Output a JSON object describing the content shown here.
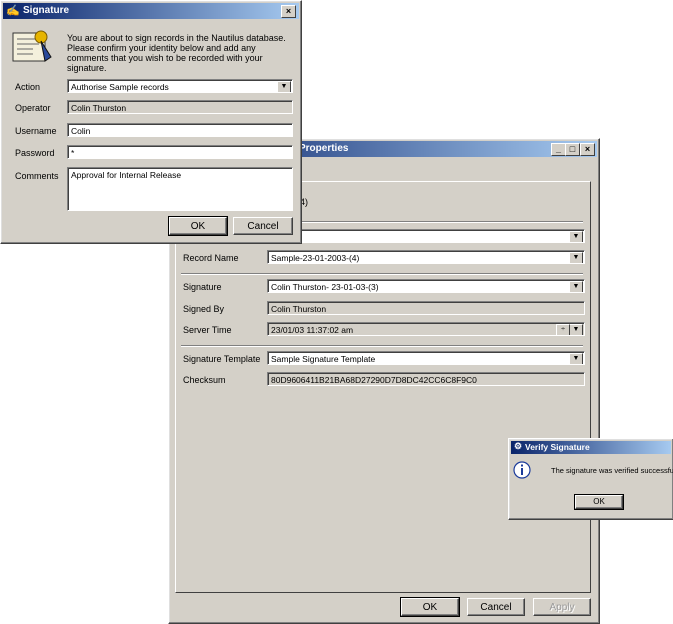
{
  "props": {
    "title": "Properties",
    "header_text": "(4)",
    "top_select": "",
    "labels": {
      "record_name": "Record Name",
      "signature": "Signature",
      "signed_by": "Signed By",
      "server_time": "Server Time",
      "signature_template": "Signature Template",
      "checksum": "Checksum"
    },
    "values": {
      "record_name": "Sample-23-01-2003-(4)",
      "signature": "Colin Thurston- 23-01-03-(3)",
      "signed_by": "Colin Thurston",
      "server_time": "23/01/03 11:37:02 am",
      "signature_template": "Sample Signature Template",
      "checksum": "80D9606411B21BA68D27290D7D8DC42CC6C8F9C0"
    },
    "buttons": {
      "ok": "OK",
      "cancel": "Cancel",
      "apply": "Apply"
    }
  },
  "sig": {
    "title": "Signature",
    "message": "You are about to sign records in the Nautilus database. Please confirm your identity below and add any comments that you wish to be recorded with your signature.",
    "labels": {
      "action": "Action",
      "operator": "Operator",
      "username": "Username",
      "password": "Password",
      "comments": "Comments"
    },
    "values": {
      "action": "Authorise Sample records",
      "operator": "Colin Thurston",
      "username": "Colin",
      "password": "*",
      "comments": "Approval for Internal Release"
    },
    "buttons": {
      "ok": "OK",
      "cancel": "Cancel"
    },
    "close": "×"
  },
  "verify": {
    "title": "Verify Signature",
    "message": "The signature was verified successfully",
    "ok": "OK"
  },
  "title_controls": {
    "minimize": "_",
    "maximize": "□",
    "close": "×"
  }
}
